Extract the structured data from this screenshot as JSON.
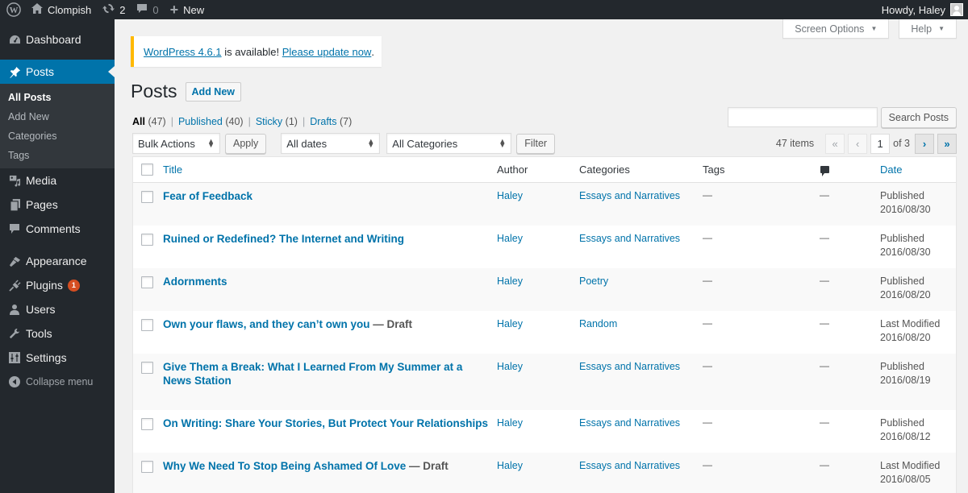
{
  "adminbar": {
    "site_name": "Clompish",
    "updates_count": "2",
    "comments_count": "0",
    "new_label": "New",
    "greeting": "Howdy, Haley"
  },
  "sidebar": {
    "items": [
      {
        "label": "Dashboard",
        "icon": "dashboard-icon"
      },
      {
        "label": "Posts",
        "icon": "pin-icon"
      },
      {
        "label": "Media",
        "icon": "media-icon"
      },
      {
        "label": "Pages",
        "icon": "pages-icon"
      },
      {
        "label": "Comments",
        "icon": "comment-icon"
      },
      {
        "label": "Appearance",
        "icon": "paintbrush-icon"
      },
      {
        "label": "Plugins",
        "icon": "plugin-icon",
        "badge": "1"
      },
      {
        "label": "Users",
        "icon": "user-icon"
      },
      {
        "label": "Tools",
        "icon": "wrench-icon"
      },
      {
        "label": "Settings",
        "icon": "settings-icon"
      }
    ],
    "posts_submenu": [
      "All Posts",
      "Add New",
      "Categories",
      "Tags"
    ],
    "collapse_label": "Collapse menu"
  },
  "screen_meta": {
    "screen_options": "Screen Options",
    "help": "Help"
  },
  "notice": {
    "version_link": "WordPress 4.6.1",
    "middle_text": " is available! ",
    "update_link": "Please update now",
    "end": "."
  },
  "page": {
    "title": "Posts",
    "add_new": "Add New"
  },
  "views": [
    {
      "label": "All",
      "count": "(47)",
      "current": true
    },
    {
      "label": "Published",
      "count": "(40)"
    },
    {
      "label": "Sticky",
      "count": "(1)"
    },
    {
      "label": "Drafts",
      "count": "(7)"
    }
  ],
  "search": {
    "value": "",
    "button": "Search Posts"
  },
  "tablenav": {
    "bulk_actions": "Bulk Actions",
    "apply": "Apply",
    "dates": "All dates",
    "categories": "All Categories",
    "filter": "Filter",
    "items_count": "47 items",
    "first_page": "«",
    "prev_page": "‹",
    "current_page": "1",
    "of_pages": "of 3",
    "next_page": "›",
    "last_page": "»"
  },
  "table": {
    "columns": {
      "title": "Title",
      "author": "Author",
      "categories": "Categories",
      "tags": "Tags",
      "comments": "comments",
      "date": "Date"
    },
    "rows": [
      {
        "title": "Fear of Feedback",
        "state": "",
        "author": "Haley",
        "category": "Essays and Narratives",
        "tags": "—",
        "comments": "—",
        "status": "Published",
        "date": "2016/08/30"
      },
      {
        "title": "Ruined or Redefined? The Internet and Writing",
        "state": "",
        "author": "Haley",
        "category": "Essays and Narratives",
        "tags": "—",
        "comments": "—",
        "status": "Published",
        "date": "2016/08/30"
      },
      {
        "title": "Adornments",
        "state": "",
        "author": "Haley",
        "category": "Poetry",
        "tags": "—",
        "comments": "—",
        "status": "Published",
        "date": "2016/08/20"
      },
      {
        "title": "Own your flaws, and they can’t own you",
        "state": " — Draft",
        "author": "Haley",
        "category": "Random",
        "tags": "—",
        "comments": "—",
        "status": "Last Modified",
        "date": "2016/08/20"
      },
      {
        "title": "Give Them a Break: What I Learned From My Summer at a News Station",
        "state": "",
        "author": "Haley",
        "category": "Essays and Narratives",
        "tags": "—",
        "comments": "—",
        "status": "Published",
        "date": "2016/08/19"
      },
      {
        "title": "On Writing: Share Your Stories, But Protect Your Relationships",
        "state": "",
        "author": "Haley",
        "category": "Essays and Narratives",
        "tags": "—",
        "comments": "—",
        "status": "Published",
        "date": "2016/08/12"
      },
      {
        "title": "Why We Need To Stop Being Ashamed Of Love",
        "state": " — Draft",
        "author": "Haley",
        "category": "Essays and Narratives",
        "tags": "—",
        "comments": "—",
        "status": "Last Modified",
        "date": "2016/08/05"
      }
    ]
  },
  "colors": {
    "accent": "#0073aa",
    "adminbar_bg": "#23282d",
    "notice_warning": "#ffb900",
    "badge": "#d54e21"
  }
}
